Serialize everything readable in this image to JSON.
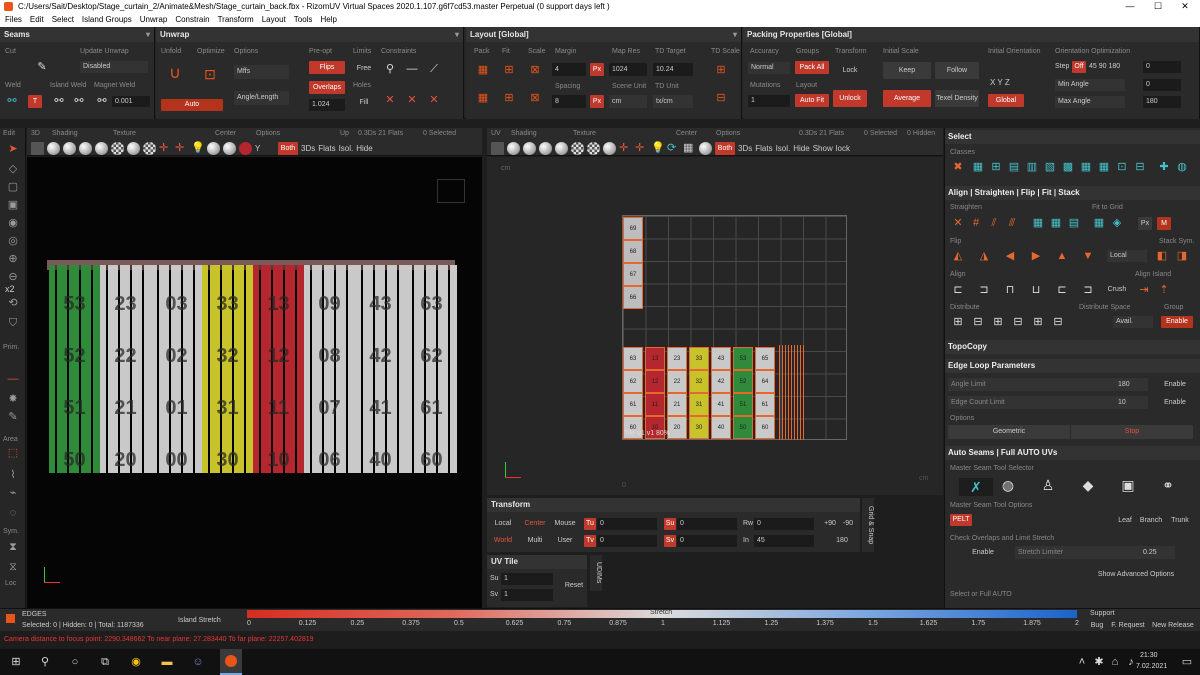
{
  "window": {
    "title": "C:/Users/Sait/Desktop/Stage_curtain_2/Animate&Mesh/Stage_curtain_back.fbx - RizomUV  Virtual Spaces 2020.1.107.g6f7cd53.master Perpetual  (0 support days left )",
    "minimize": "—",
    "maximize": "☐",
    "close": "✕"
  },
  "menu": [
    "Files",
    "Edit",
    "Select",
    "Island Groups",
    "Unwrap",
    "Constrain",
    "Transform",
    "Layout",
    "Tools",
    "Help"
  ],
  "seams": {
    "title": "Seams",
    "cut": "Cut",
    "update_unwrap": "Update Unwrap",
    "disabled": "Disabled",
    "weld": "Weld",
    "island_weld": "Island Weld",
    "magnet_weld": "Magnet Weld",
    "magnet_value": "0.001"
  },
  "unwrap": {
    "title": "Unwrap",
    "unfold": "Unfold",
    "optimize": "Optimize",
    "options": "Options",
    "pre_opt": "Pre-opt",
    "limits": "Limits",
    "constraints": "Constraints",
    "mode": "Mffs",
    "angle_length": "Angle/Length",
    "flips": "Flips",
    "free": "Free",
    "overlaps": "Overlaps",
    "holes": "Holes",
    "fill": "Fill",
    "auto": "Auto",
    "ratio": "1.024"
  },
  "layout": {
    "title": "Layout [Global]",
    "pack": "Pack",
    "fit": "Fit",
    "scale": "Scale",
    "margin": "Margin",
    "margin_value": "4",
    "spacing": "Spacing",
    "spacing_value": "8",
    "px": "Px",
    "map_res": "Map Res",
    "map_res_value": "1024",
    "td_target": "TD Target",
    "td_target_value": "10.24",
    "scene_unit": "Scene Unit",
    "scene_unit_value": "cm",
    "td_unit": "TD Unit",
    "td_unit_value": "tx/cm",
    "td_scale": "TD Scale"
  },
  "packing": {
    "title": "Packing Properties [Global]",
    "accuracy": "Accuracy",
    "accuracy_value": "Normal",
    "groups": "Groups",
    "pack_all": "Pack All",
    "transform": "Transform",
    "lock": "Lock",
    "mutations": "Mutations",
    "mutations_value": "1",
    "layout": "Layout",
    "auto_fit": "Auto Fit",
    "unlock": "Unlock",
    "initial_scale": "Initial Scale",
    "keep": "Keep",
    "follow": "Follow",
    "average": "Average",
    "texel_density": "Texel Density",
    "initial_orientation": "Initial Orientation",
    "xyz": "X  Y  Z",
    "global": "Global",
    "orientation_optimization": "Orientation Optimization",
    "step": "Step",
    "off": "Off",
    "steps": "45  90  180",
    "step_value": "0",
    "min_angle": "Min Angle",
    "min_value": "0",
    "max_angle": "Max Angle",
    "max_value": "180"
  },
  "viewport3d": {
    "edit": "Edit",
    "mode": "3D",
    "shading": "Shading",
    "texture": "Texture",
    "center": "Center",
    "options": "Options",
    "up": "Up",
    "stats": "0.3Ds 21 Flats",
    "selected": "0 Selected",
    "y_axis": "Y",
    "both": "Both",
    "ds3": "3Ds",
    "flats": "Flats",
    "isol": "Isol.",
    "hide": "Hide",
    "show": "Show"
  },
  "uvview": {
    "mode": "UV",
    "shading": "Shading",
    "texture": "Texture",
    "center": "Center",
    "options": "Options",
    "stats": "0.3Ds 21 Flats",
    "selected": "0 Selected",
    "hidden": "0 Hidden",
    "both": "Both",
    "ds3": "3Ds",
    "flats": "Flats",
    "isol": "Isol.",
    "hide": "Hide",
    "show": "Show",
    "lock": "lock",
    "tile_label": "Tile u1 v1 80%",
    "cm_top": "cm",
    "cm_right": "cm",
    "zero": "0"
  },
  "curtains": [
    {
      "color": "#2f8a3a",
      "labels": [
        "53",
        "52",
        "51",
        "50"
      ]
    },
    {
      "color": "#c9c9c9",
      "labels": [
        "23",
        "22",
        "21",
        "20"
      ]
    },
    {
      "color": "#c9c9c9",
      "labels": [
        "03",
        "02",
        "01",
        "00"
      ]
    },
    {
      "color": "#c8c32a",
      "labels": [
        "33",
        "32",
        "31",
        "30"
      ]
    },
    {
      "color": "#b5262e",
      "labels": [
        "13",
        "12",
        "11",
        "10"
      ]
    },
    {
      "color": "#c9c9c9",
      "labels": [
        "09",
        "08",
        "07",
        "06"
      ]
    },
    {
      "color": "#c9c9c9",
      "labels": [
        "43",
        "42",
        "41",
        "40"
      ]
    },
    {
      "color": "#c9c9c9",
      "labels": [
        "63",
        "62",
        "61",
        "60"
      ]
    }
  ],
  "uv_top_column": [
    "69",
    "68",
    "67",
    "66"
  ],
  "uv_grid": [
    {
      "color": "#c9c9c9",
      "labels": [
        "63",
        "62",
        "61",
        "60"
      ]
    },
    {
      "color": "#b5262e",
      "labels": [
        "13",
        "12",
        "11",
        "10"
      ]
    },
    {
      "color": "#c9c9c9",
      "labels": [
        "23",
        "22",
        "21",
        "20"
      ]
    },
    {
      "color": "#c8c32a",
      "labels": [
        "33",
        "32",
        "31",
        "30"
      ]
    },
    {
      "color": "#c9c9c9",
      "labels": [
        "43",
        "42",
        "41",
        "40"
      ]
    },
    {
      "color": "#2f8a3a",
      "labels": [
        "53",
        "52",
        "51",
        "50"
      ]
    },
    {
      "color": "#c9c9c9",
      "labels": [
        "65",
        "64",
        "61",
        "60"
      ]
    }
  ],
  "left_tools": {
    "x2": "x2",
    "prim": "Prim.",
    "area": "Area",
    "sym": "Sym.",
    "loc": "Loc"
  },
  "right_panel": {
    "select": "Select",
    "classes": "Classes",
    "align_title": "Align | Straighten | Flip | Fit | Stack",
    "straighten": "Straighten",
    "fit_to_grid": "Fit to Grid",
    "px": "Px",
    "m": "M",
    "flip": "Flip",
    "stack_sym": "Stack Sym.",
    "local": "Local",
    "align": "Align",
    "align_island": "Align Island",
    "crush": "Crush",
    "distribute": "Distribute",
    "distribute_space": "Distribute Space",
    "group": "Group",
    "avail": "Avail.",
    "enable": "Enable",
    "topocopy": "TopoCopy",
    "edge_loop_title": "Edge Loop Parameters",
    "angle_limit": "Angle Limit",
    "angle_value": "180",
    "edge_count_limit": "Edge Count Limit",
    "edge_count_value": "10",
    "options": "Options",
    "geometric": "Geometric",
    "stop": "Stop",
    "auto_seams_title": "Auto Seams | Full AUTO UVs",
    "master_seam": "Master Seam Tool Selector",
    "master_seam_options": "Master Seam Tool Options",
    "pelt": "PELT",
    "leaf": "Leaf",
    "branch": "Branch",
    "trunk": "Trunk",
    "check_overlaps": "Check Overlaps and Limit Stretch",
    "stretch_limiter": "Stretch Limiter",
    "stretch_value": "0.25",
    "show_advanced": "Show Advanced Options",
    "select_or_full": "Select or Full AUTO"
  },
  "transform_panel": {
    "title": "Transform",
    "local": "Local",
    "center": "Center",
    "mouse": "Mouse",
    "world": "World",
    "multi": "Multi",
    "user": "User",
    "tu": "Tu",
    "tv": "Tv",
    "su": "Su",
    "sv": "Sv",
    "rw": "Rw",
    "in": "In",
    "tu_val": "0",
    "tv_val": "0",
    "su_val": "0",
    "sv_val": "0",
    "rw_val": "0",
    "in_val": "45",
    "p90": "+90",
    "m90": "-90",
    "v180": "180",
    "grid_snap": "Grid & Snap"
  },
  "uvtile": {
    "title": "UV Tile",
    "su": "Su",
    "su_val": "1",
    "sv": "Sv",
    "sv_val": "1",
    "reset": "Reset",
    "udims": "UDIMs"
  },
  "status": {
    "mode": "EDGES",
    "counts": "Selected: 0 | Hidden: 0 | Total: 1187336",
    "island_stretch": "Island Stretch",
    "stretch": "Stretch",
    "ticks": [
      "0",
      "0.125",
      "0.25",
      "0.375",
      "0.5",
      "0.625",
      "0.75",
      "0.875",
      "1",
      "1.125",
      "1.25",
      "1.375",
      "1.5",
      "1.625",
      "1.75",
      "1.875",
      "2"
    ],
    "support": "Support",
    "bug": "Bug",
    "feature_request": "F. Request",
    "new_release": "New Release"
  },
  "console": "Camera distance to focus point: 2290.348662  To near plane: 27.283440  To far plane: 22257.402819",
  "taskbar": {
    "time": "21:30",
    "date": "7.02.2021"
  },
  "colors": {
    "accent": "#e8672f",
    "red": "#c0392b",
    "teal": "#44c1c8"
  }
}
